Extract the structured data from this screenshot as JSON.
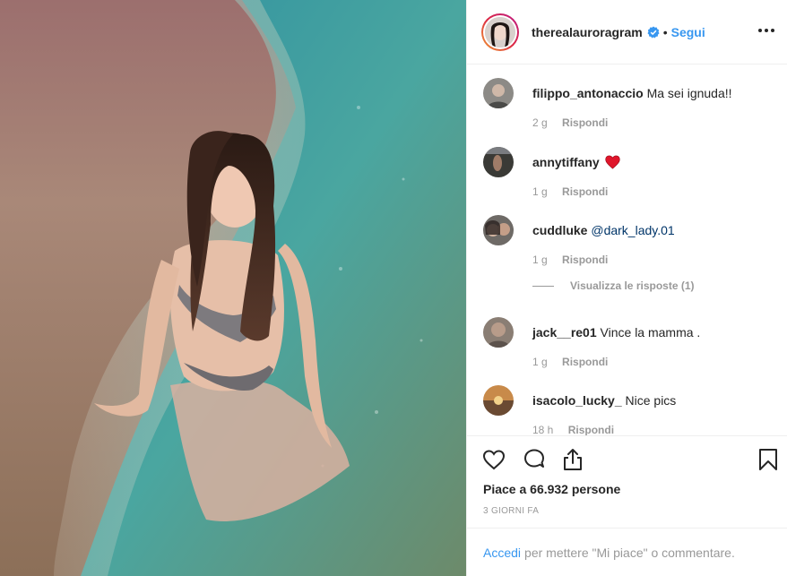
{
  "post": {
    "username": "therealauroragram",
    "separator": "•",
    "follow_label": "Segui",
    "likes_text": "Piace a 66.932 persone",
    "time_ago": "3 GIORNI FA"
  },
  "comments": [
    {
      "user": "filippo_antonaccio",
      "text": "Ma sei ignuda!!",
      "age": "2 g",
      "reply_label": "Rispondi"
    },
    {
      "user": "annytiffany",
      "text": "",
      "age": "1 g",
      "reply_label": "Rispondi",
      "emoji": "heart"
    },
    {
      "user": "cuddluke",
      "text": "@dark_lady.01",
      "age": "1 g",
      "reply_label": "Rispondi"
    },
    {
      "user": "jack__re01",
      "text": "Vince la mamma .",
      "age": "1 g",
      "reply_label": "Rispondi"
    },
    {
      "user": "isacolo_lucky_",
      "text": "Nice pics",
      "age": "18 h",
      "reply_label": "Rispondi"
    }
  ],
  "view_replies": "Visualizza le risposte (1)",
  "footer": {
    "login_label": "Accedi",
    "rest_text": "per mettere \"Mi piace\" o commentare."
  },
  "colors": {
    "link_blue": "#3897f0",
    "mention_blue": "#003569",
    "muted_gray": "#999999",
    "heart_red": "#ed4956"
  },
  "icons": [
    "verified-badge-icon",
    "more-options-icon",
    "heart-icon",
    "comment-icon",
    "share-icon",
    "bookmark-icon"
  ]
}
